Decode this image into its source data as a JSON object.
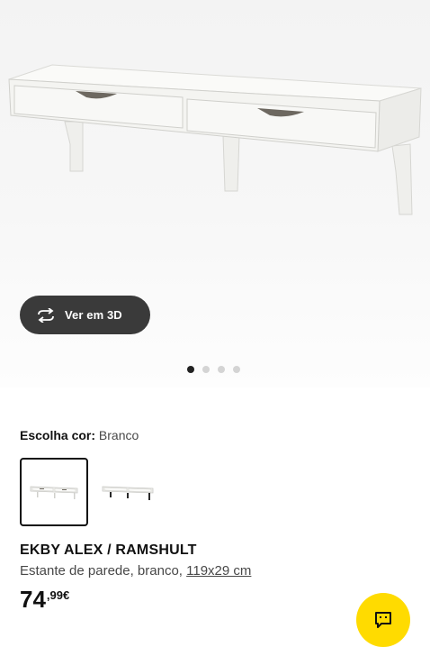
{
  "gallery": {
    "view_3d_label": "Ver em 3D",
    "dots_count": 4,
    "active_dot": 0
  },
  "color_select": {
    "label": "Escolha cor:",
    "value": "Branco",
    "options_count": 2,
    "selected_index": 0
  },
  "product": {
    "name": "EKBY ALEX / RAMSHULT",
    "description": "Estante de parede, branco,",
    "dimensions": "119x29 cm",
    "price_integer": "74",
    "price_decimal": ",99€"
  },
  "icons": {
    "view_3d": "rotate-3d-icon",
    "chat": "chat-bubble-icon"
  },
  "colors": {
    "button_dark": "#3a3a3a",
    "chat_yellow": "#ffdb00",
    "active_dot": "#222222",
    "inactive_dot": "#d4d4d4"
  }
}
